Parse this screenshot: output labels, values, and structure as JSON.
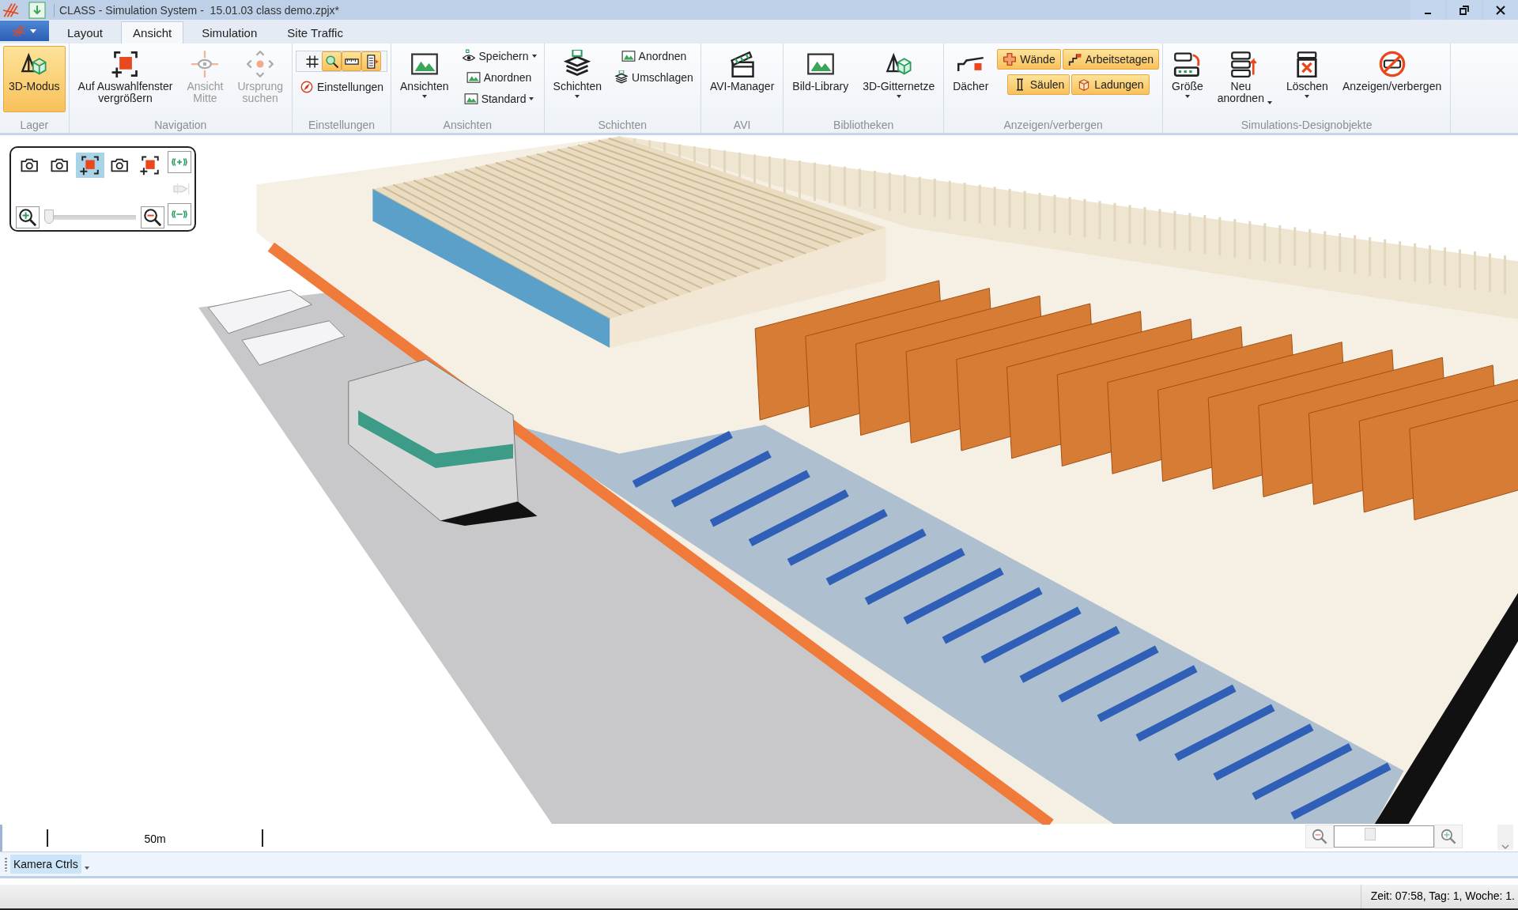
{
  "window": {
    "title": "CLASS - Simulation System -  15.01.03 class demo.zpjx*"
  },
  "tabs": [
    {
      "label": "Layout",
      "selected": false
    },
    {
      "label": "Ansicht",
      "selected": true
    },
    {
      "label": "Simulation",
      "selected": false
    },
    {
      "label": "Site Traffic",
      "selected": false
    }
  ],
  "ribbon": [
    {
      "label": "Lager",
      "columns": [
        {
          "rows": [
            [
              {
                "kind": "large",
                "label": "3D-Modus",
                "active": true,
                "disabled": false,
                "dropdown": false
              }
            ]
          ]
        }
      ]
    },
    {
      "label": "Navigation",
      "columns": [
        {
          "rows": [
            [
              {
                "kind": "large",
                "label": "Auf Auswahlfenster\nvergrößern",
                "active": false,
                "disabled": false,
                "dropdown": false
              }
            ]
          ]
        },
        {
          "rows": [
            [
              {
                "kind": "large",
                "label": "Ansicht\nMitte",
                "active": false,
                "disabled": true,
                "dropdown": false
              }
            ]
          ]
        },
        {
          "rows": [
            [
              {
                "kind": "large",
                "label": "Ursprung\nsuchen",
                "active": false,
                "disabled": true,
                "dropdown": false
              }
            ]
          ]
        }
      ]
    },
    {
      "label": "Einstellungen",
      "columns": [
        {
          "rows": [
            [
              {
                "kind": "icon",
                "active": false
              },
              {
                "kind": "icon",
                "active": true
              },
              {
                "kind": "icon",
                "active": true
              },
              {
                "kind": "icon",
                "active": true
              }
            ],
            [
              {
                "kind": "small",
                "label": "Einstellungen",
                "active": false,
                "disabled": false,
                "dropdown": false
              }
            ]
          ]
        }
      ]
    },
    {
      "label": "Ansichten",
      "columns": [
        {
          "rows": [
            [
              {
                "kind": "large",
                "label": "Ansichten",
                "active": false,
                "disabled": false,
                "dropdown": true
              }
            ]
          ]
        },
        {
          "rows": [
            [
              {
                "kind": "small",
                "label": "Speichern",
                "active": false,
                "disabled": false,
                "dropdown": true
              }
            ],
            [
              {
                "kind": "small",
                "label": "Anordnen",
                "active": false,
                "disabled": false,
                "dropdown": false
              }
            ],
            [
              {
                "kind": "small",
                "label": "Standard",
                "active": false,
                "disabled": false,
                "dropdown": true
              }
            ]
          ]
        }
      ]
    },
    {
      "label": "Schichten",
      "columns": [
        {
          "rows": [
            [
              {
                "kind": "large",
                "label": "Schichten",
                "active": false,
                "disabled": false,
                "dropdown": true
              }
            ]
          ]
        },
        {
          "rows": [
            [
              {
                "kind": "small",
                "label": "Anordnen",
                "active": false,
                "disabled": false,
                "dropdown": false
              }
            ],
            [
              {
                "kind": "small",
                "label": "Umschlagen",
                "active": false,
                "disabled": false,
                "dropdown": false
              }
            ]
          ]
        }
      ]
    },
    {
      "label": "AVI",
      "columns": [
        {
          "rows": [
            [
              {
                "kind": "large",
                "label": "AVI-Manager",
                "active": false,
                "disabled": false,
                "dropdown": false
              }
            ]
          ]
        }
      ]
    },
    {
      "label": "Bibliotheken",
      "columns": [
        {
          "rows": [
            [
              {
                "kind": "large",
                "label": "Bild-Library",
                "active": false,
                "disabled": false,
                "dropdown": false
              }
            ]
          ]
        },
        {
          "rows": [
            [
              {
                "kind": "large",
                "label": "3D-Gitternetze",
                "active": false,
                "disabled": false,
                "dropdown": true
              }
            ]
          ]
        }
      ]
    },
    {
      "label": "Anzeigen/verbergen",
      "columns": [
        {
          "rows": [
            [
              {
                "kind": "large",
                "label": "Dächer",
                "active": false,
                "disabled": false,
                "dropdown": false
              }
            ]
          ]
        },
        {
          "rows": [
            [
              {
                "kind": "toggle",
                "label": "Wände",
                "active": true,
                "disabled": false,
                "dropdown": false
              },
              {
                "kind": "toggle",
                "label": "Arbeitsetagen",
                "active": true,
                "disabled": false,
                "dropdown": false
              }
            ],
            [
              {
                "kind": "toggle",
                "label": "Säulen",
                "active": true,
                "disabled": false,
                "dropdown": false
              },
              {
                "kind": "toggle",
                "label": "Ladungen",
                "active": true,
                "disabled": false,
                "dropdown": false
              }
            ]
          ]
        }
      ]
    },
    {
      "label": "Simulations-Designobjekte",
      "columns": [
        {
          "rows": [
            [
              {
                "kind": "large",
                "label": "Größe",
                "active": false,
                "disabled": false,
                "dropdown": true
              }
            ]
          ]
        },
        {
          "rows": [
            [
              {
                "kind": "large",
                "label": "Neu\nanordnen",
                "active": false,
                "disabled": false,
                "dropdown": true
              }
            ]
          ]
        },
        {
          "rows": [
            [
              {
                "kind": "large",
                "label": "Löschen",
                "active": false,
                "disabled": false,
                "dropdown": true
              }
            ]
          ]
        },
        {
          "rows": [
            [
              {
                "kind": "large",
                "label": "Anzeigen/verbergen",
                "active": false,
                "disabled": false,
                "dropdown": false
              }
            ]
          ]
        }
      ]
    }
  ],
  "camera_panel": {
    "modes": [
      {
        "selected": false
      },
      {
        "selected": false
      },
      {
        "selected": true
      },
      {
        "selected": false
      },
      {
        "selected": false
      }
    ],
    "zoom": {
      "level": 0
    }
  },
  "scale_bar": {
    "label": "50m"
  },
  "zoom_control": {
    "level": 0.3
  },
  "bottom_toolbar": {
    "tabs": [
      {
        "label": "Kamera Ctrls",
        "selected": true
      }
    ]
  },
  "status_bar": {
    "text": "Zeit: 07:58, Tag: 1, Woche: 1."
  }
}
